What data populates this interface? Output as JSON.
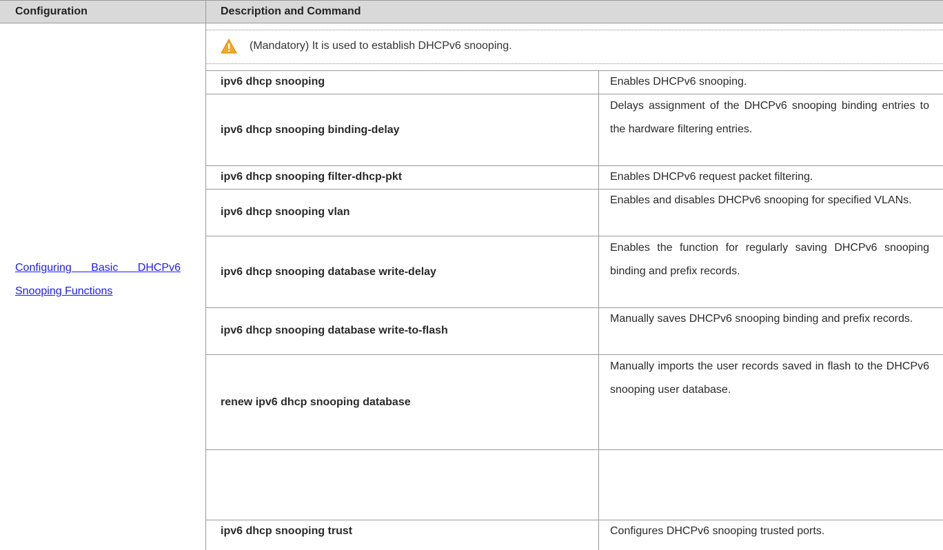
{
  "table": {
    "header": {
      "col1": "Configuration",
      "col2": "Description and Command"
    },
    "config_link": "Configuring Basic DHCPv6 Snooping Functions",
    "note": {
      "icon": "warning-triangle-icon",
      "text": "(Mandatory) It is used to establish DHCPv6 snooping."
    },
    "rows": [
      {
        "command": "ipv6 dhcp snooping",
        "description": "Enables DHCPv6 snooping."
      },
      {
        "command": "ipv6 dhcp snooping binding-delay",
        "description": "Delays assignment of the DHCPv6 snooping binding entries to the hardware filtering entries."
      },
      {
        "command": "ipv6 dhcp snooping filter-dhcp-pkt",
        "description": "Enables DHCPv6 request packet filtering."
      },
      {
        "command": "ipv6 dhcp snooping vlan",
        "description": "Enables and disables DHCPv6 snooping for specified VLANs."
      },
      {
        "command": "ipv6 dhcp snooping database write-delay",
        "description": "Enables the function for regularly saving DHCPv6 snooping binding and prefix records."
      },
      {
        "command": "ipv6 dhcp snooping database write-to-flash",
        "description": "Manually saves DHCPv6 snooping binding and prefix records."
      },
      {
        "command": "renew ipv6 dhcp snooping database",
        "description": "Manually imports the user records saved in flash to the DHCPv6 snooping user database."
      },
      {
        "command": "ipv6 dhcp snooping trust",
        "description": "Configures DHCPv6 snooping trusted ports."
      }
    ]
  },
  "colors": {
    "header_bg": "#d9d9d9",
    "grid": "#9a9a9a",
    "link": "#1a1aff",
    "warning": "#f5a623"
  }
}
